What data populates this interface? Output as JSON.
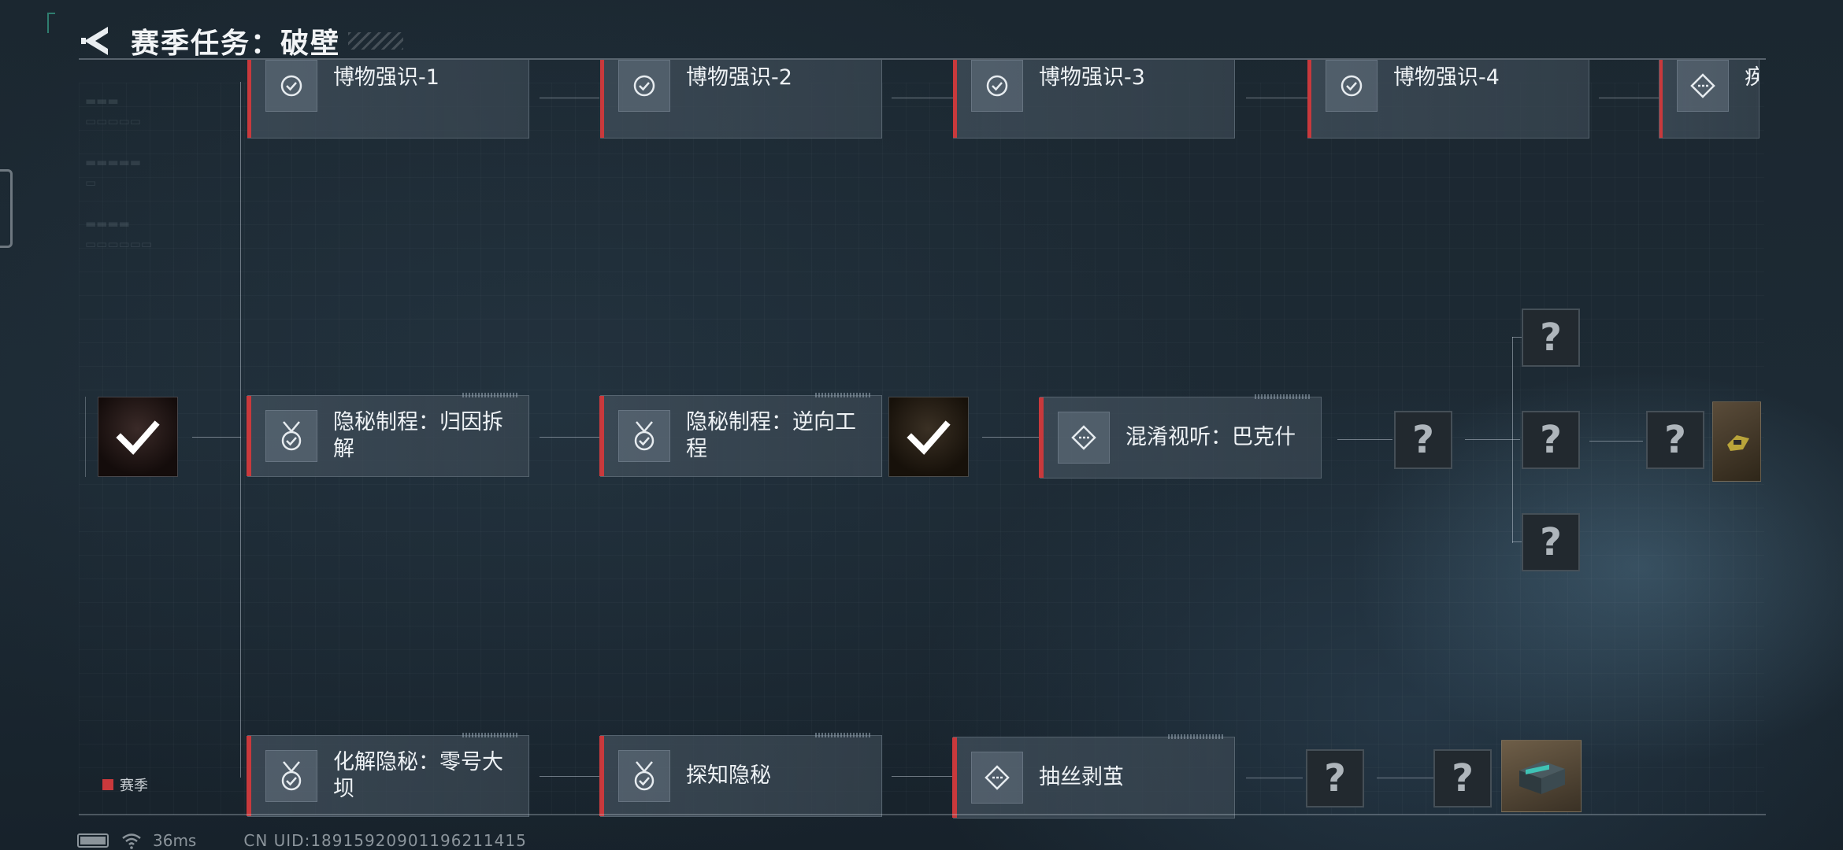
{
  "header": {
    "title": "赛季任务：破壁"
  },
  "tasks": {
    "bowu1": "博物强识-1",
    "bowu2": "博物强识-2",
    "bowu3": "博物强识-3",
    "bowu4": "博物强识-4",
    "bowu5": "疾",
    "yinmi1": "隐秘制程：归因拆解",
    "yinmi2": "隐秘制程：逆向工程",
    "hunxiao": "混淆视听：巴克什",
    "huajie": "化解隐秘：零号大坝",
    "tanzhi": "探知隐秘",
    "chousi": "抽丝剥茧"
  },
  "unknown_mark": "?",
  "legend": {
    "label": "赛季",
    "color": "#c9393c"
  },
  "status": {
    "ping": "36ms",
    "uid": "CN UID:18915920901196211415"
  },
  "colors": {
    "accent_red": "#c9393c",
    "check_white": "#ffffff"
  }
}
